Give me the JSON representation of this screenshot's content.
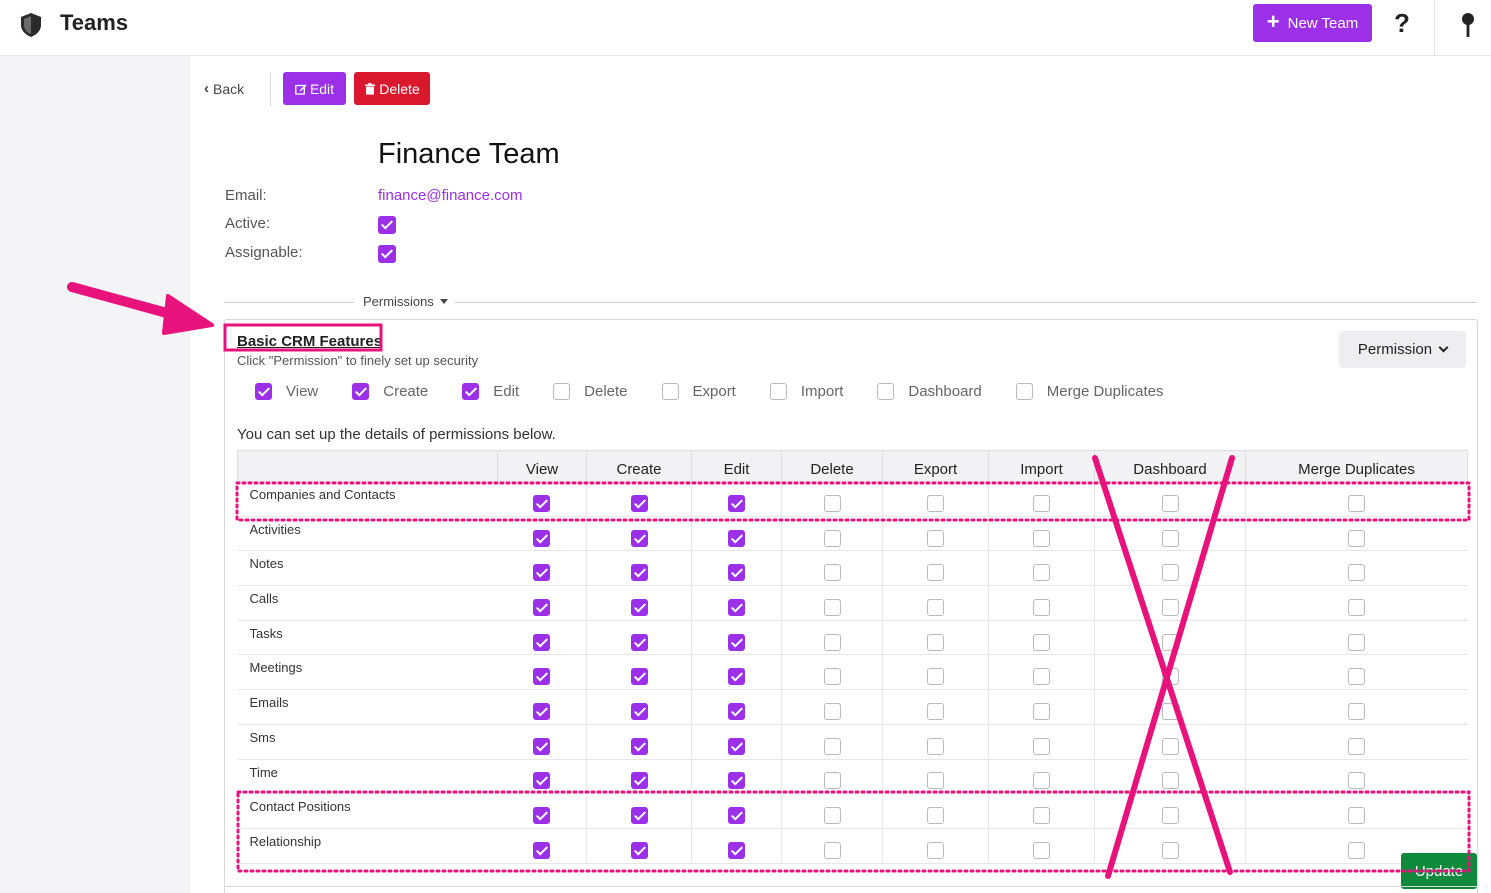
{
  "topbar": {
    "title": "Teams",
    "new_team_label": "New Team",
    "help_glyph": "?"
  },
  "toolbar": {
    "back_label": "Back",
    "edit_label": "Edit",
    "delete_label": "Delete"
  },
  "team": {
    "name": "Finance Team",
    "email_label": "Email:",
    "email_value": "finance@finance.com",
    "active_label": "Active:",
    "active": true,
    "assignable_label": "Assignable:",
    "assignable": true
  },
  "permissions": {
    "toggle_label": "Permissions",
    "section_title": "Basic CRM Features",
    "hint": "Click \"Permission\" to finely set up security",
    "dropdown_label": "Permission",
    "details_note": "You can set up the details of permissions below.",
    "columns": [
      "View",
      "Create",
      "Edit",
      "Delete",
      "Export",
      "Import",
      "Dashboard",
      "Merge Duplicates"
    ],
    "master": [
      true,
      true,
      true,
      false,
      false,
      false,
      false,
      false
    ],
    "rows": [
      {
        "name": "Companies and Contacts",
        "values": [
          true,
          true,
          true,
          false,
          false,
          false,
          false,
          false
        ]
      },
      {
        "name": "Activities",
        "values": [
          true,
          true,
          true,
          false,
          false,
          false,
          false,
          false
        ]
      },
      {
        "name": "Notes",
        "values": [
          true,
          true,
          true,
          false,
          false,
          false,
          false,
          false
        ]
      },
      {
        "name": "Calls",
        "values": [
          true,
          true,
          true,
          false,
          false,
          false,
          false,
          false
        ]
      },
      {
        "name": "Tasks",
        "values": [
          true,
          true,
          true,
          false,
          false,
          false,
          false,
          false
        ]
      },
      {
        "name": "Meetings",
        "values": [
          true,
          true,
          true,
          false,
          false,
          false,
          false,
          false
        ]
      },
      {
        "name": "Emails",
        "values": [
          true,
          true,
          true,
          false,
          false,
          false,
          false,
          false
        ]
      },
      {
        "name": "Sms",
        "values": [
          true,
          true,
          true,
          false,
          false,
          false,
          false,
          false
        ]
      },
      {
        "name": "Time",
        "values": [
          true,
          true,
          true,
          false,
          false,
          false,
          false,
          false
        ]
      },
      {
        "name": "Contact Positions",
        "values": [
          true,
          true,
          true,
          false,
          false,
          false,
          false,
          false
        ]
      },
      {
        "name": "Relationship",
        "values": [
          true,
          true,
          true,
          false,
          false,
          false,
          false,
          false
        ]
      }
    ]
  },
  "footer": {
    "update_label": "Update"
  },
  "annotations": {
    "color": "#e8127c"
  },
  "colors": {
    "accent": "#9b30e8",
    "danger": "#d9182e",
    "success": "#0f8a3c"
  }
}
